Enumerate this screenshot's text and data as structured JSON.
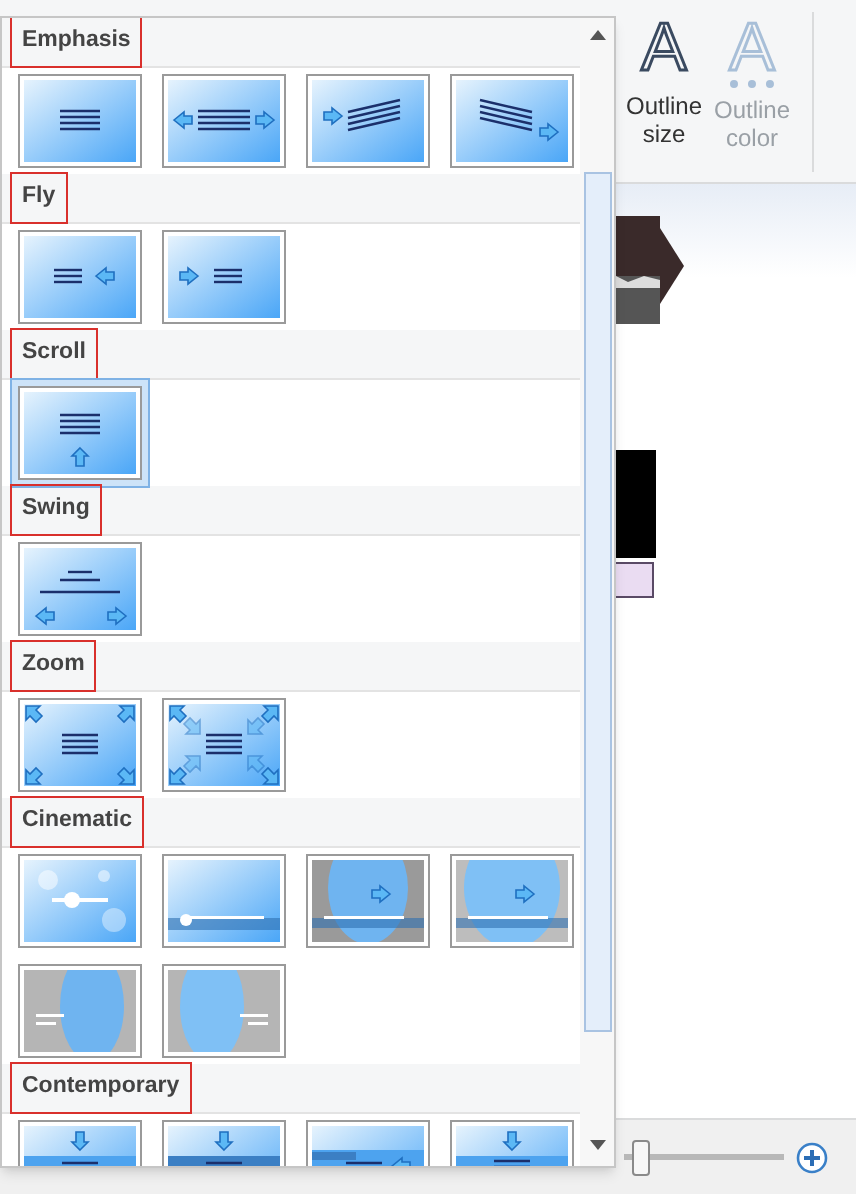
{
  "ribbon": {
    "buttons": [
      {
        "glyph": "A",
        "label": "Outline size",
        "disabled": false
      },
      {
        "glyph": "A",
        "label": "Outline color",
        "disabled": true
      }
    ]
  },
  "effects_menu": {
    "sections": [
      {
        "heading": "Emphasis",
        "highlighted": true,
        "items": [
          {
            "kind": "center-lines",
            "selected": false
          },
          {
            "kind": "expand-sideways",
            "selected": false
          },
          {
            "kind": "tilt-in",
            "selected": false
          },
          {
            "kind": "tilt-out",
            "selected": false
          }
        ]
      },
      {
        "heading": "Fly",
        "highlighted": true,
        "items": [
          {
            "kind": "fly-left",
            "selected": false
          },
          {
            "kind": "fly-right",
            "selected": false
          }
        ]
      },
      {
        "heading": "Scroll",
        "highlighted": true,
        "items": [
          {
            "kind": "scroll-up",
            "selected": true
          }
        ]
      },
      {
        "heading": "Swing",
        "highlighted": true,
        "items": [
          {
            "kind": "swing",
            "selected": false
          }
        ]
      },
      {
        "heading": "Zoom",
        "highlighted": true,
        "items": [
          {
            "kind": "zoom-in",
            "selected": false
          },
          {
            "kind": "zoom-out",
            "selected": false
          }
        ]
      },
      {
        "heading": "Cinematic",
        "highlighted": true,
        "items": [
          {
            "kind": "sparkle",
            "selected": false
          },
          {
            "kind": "light-bar",
            "selected": false
          },
          {
            "kind": "spotlight-gray",
            "selected": false
          },
          {
            "kind": "spotlight-blue",
            "selected": false
          },
          {
            "kind": "split-left",
            "selected": false
          },
          {
            "kind": "split-right",
            "selected": false
          }
        ]
      },
      {
        "heading": "Contemporary",
        "highlighted": true,
        "items": [
          {
            "kind": "drop-band",
            "selected": false
          },
          {
            "kind": "drop-dark-band",
            "selected": false
          },
          {
            "kind": "slide-left",
            "selected": false
          },
          {
            "kind": "drop-offset",
            "selected": false
          }
        ]
      }
    ]
  },
  "zoom_slider": {
    "level": 0.05
  }
}
